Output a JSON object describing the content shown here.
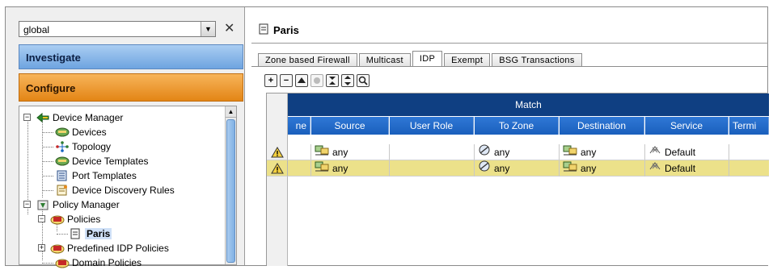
{
  "left_panel": {
    "scope_select": {
      "value": "global"
    },
    "close_glyph": "✕",
    "accordion": {
      "investigate": "Investigate",
      "configure": "Configure"
    },
    "tree": {
      "device_manager": "Device Manager",
      "devices": "Devices",
      "topology": "Topology",
      "device_templates": "Device Templates",
      "port_templates": "Port Templates",
      "device_discovery_rules": "Device Discovery Rules",
      "policy_manager": "Policy Manager",
      "policies": "Policies",
      "paris": "Paris",
      "predefined_idp_policies": "Predefined IDP Policies",
      "domain_policies": "Domain Policies"
    }
  },
  "document": {
    "title": "Paris",
    "tabs": [
      {
        "label": "Zone based Firewall"
      },
      {
        "label": "Multicast"
      },
      {
        "label": "IDP"
      },
      {
        "label": "Exempt"
      },
      {
        "label": "BSG Transactions"
      }
    ],
    "active_tab": "IDP",
    "toolbar_icons": [
      "add-icon",
      "remove-icon",
      "move-up-icon",
      "disabled-icon",
      "collapse-icon",
      "expand-icon",
      "find-icon"
    ]
  },
  "table": {
    "group_header": "Match",
    "columns": [
      "ne",
      "Source",
      "User Role",
      "To Zone",
      "Destination",
      "Service",
      "Termi"
    ],
    "rows": [
      {
        "source": "any",
        "user_role": "",
        "to_zone": "any",
        "destination": "any",
        "service": "Default"
      },
      {
        "source": "any",
        "user_role": "",
        "to_zone": "any",
        "destination": "any",
        "service": "Default"
      }
    ]
  },
  "colors": {
    "match_bar": "#0f3f82",
    "column_header": "#1a5fbc",
    "highlight_row": "#ece18a",
    "investigate": "#6ea4e0",
    "configure": "#e38515"
  }
}
